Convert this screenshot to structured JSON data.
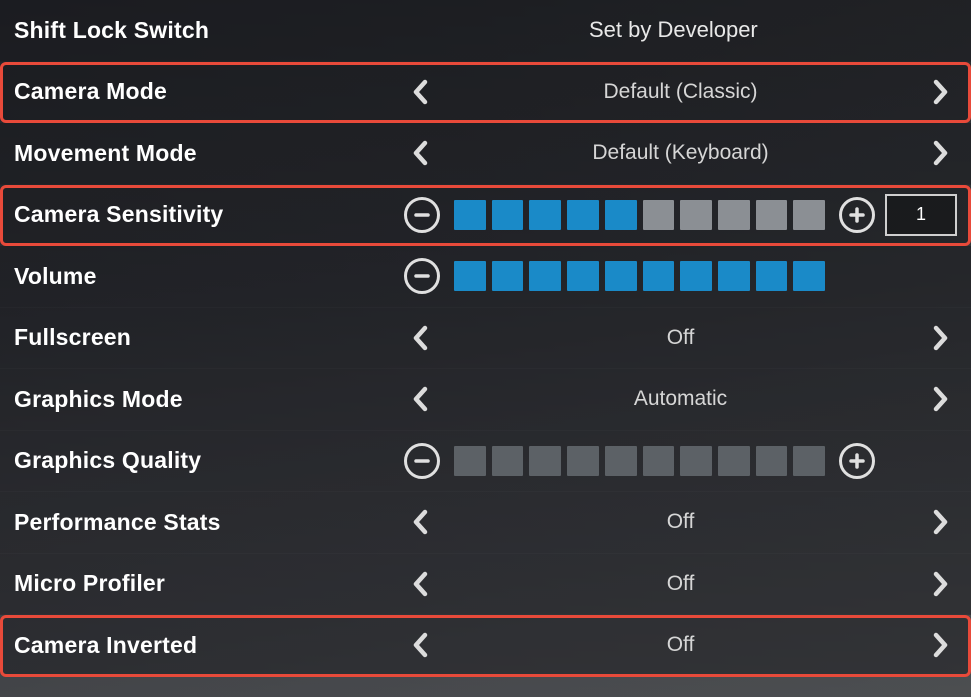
{
  "settings": {
    "shift_lock": {
      "label": "Shift Lock Switch",
      "value": "Set by Developer"
    },
    "camera_mode": {
      "label": "Camera Mode",
      "value": "Default (Classic)"
    },
    "movement_mode": {
      "label": "Movement Mode",
      "value": "Default (Keyboard)"
    },
    "camera_sensitivity": {
      "label": "Camera Sensitivity",
      "level": 5,
      "max": 10,
      "numeric": "1"
    },
    "volume": {
      "label": "Volume",
      "level": 10,
      "max": 10
    },
    "fullscreen": {
      "label": "Fullscreen",
      "value": "Off"
    },
    "graphics_mode": {
      "label": "Graphics Mode",
      "value": "Automatic"
    },
    "graphics_quality": {
      "label": "Graphics Quality",
      "level": 0,
      "max": 10
    },
    "performance_stats": {
      "label": "Performance Stats",
      "value": "Off"
    },
    "micro_profiler": {
      "label": "Micro Profiler",
      "value": "Off"
    },
    "camera_inverted": {
      "label": "Camera Inverted",
      "value": "Off"
    }
  },
  "highlight_color": "#e84a3a",
  "accent_color": "#1a8ac8"
}
